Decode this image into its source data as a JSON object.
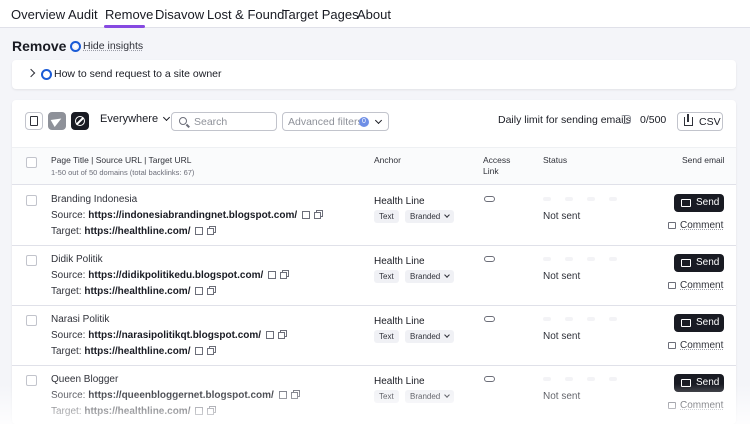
{
  "nav": {
    "tabs": [
      {
        "label": "Overview"
      },
      {
        "label": "Audit"
      },
      {
        "label": "Remove"
      },
      {
        "label": "Disavow"
      },
      {
        "label": "Lost & Found"
      },
      {
        "label": "Target Pages"
      },
      {
        "label": "About"
      }
    ],
    "active": "Remove"
  },
  "page": {
    "title": "Remove",
    "hide_insights": "Hide insights"
  },
  "howto": {
    "label": "How to send request to a site owner"
  },
  "toolbar": {
    "scope_select": "Everywhere",
    "search_placeholder": "Search",
    "advanced_filters": "Advanced filters",
    "advanced_filters_count": "0",
    "daily_limit_label": "Daily limit for sending emails",
    "daily_limit_value": "0/500",
    "csv_label": "CSV"
  },
  "table": {
    "headers": {
      "page": "Page Title | Source URL | Target URL",
      "page_sub": "1-50 out of 50 domains (total backlinks: 67)",
      "anchor": "Anchor",
      "access_line1": "Access",
      "access_line2": "Link",
      "status": "Status",
      "send_email": "Send email"
    },
    "source_prefix": "Source: ",
    "target_prefix": "Target: ",
    "send_label": "Send",
    "comment_label": "Comment",
    "rows": [
      {
        "name": "Branding Indonesia",
        "source": "https://indonesiabrandingnet.blogspot.com/",
        "target": "https://healthline.com/",
        "anchor": "Health Line",
        "tag_type": "Text",
        "tag_branded": "Branded",
        "status": "Not sent"
      },
      {
        "name": "Didik Politik",
        "source": "https://didikpolitikedu.blogspot.com/",
        "target": "https://healthline.com/",
        "anchor": "Health Line",
        "tag_type": "Text",
        "tag_branded": "Branded",
        "status": "Not sent"
      },
      {
        "name": "Narasi Politik",
        "source": "https://narasipolitikqt.blogspot.com/",
        "target": "https://healthline.com/",
        "anchor": "Health Line",
        "tag_type": "Text",
        "tag_branded": "Branded",
        "status": "Not sent"
      },
      {
        "name": "Queen Blogger",
        "source": "https://queenbloggernet.blogspot.com/",
        "target": "https://healthline.com/",
        "anchor": "Health Line",
        "tag_type": "Text",
        "tag_branded": "Branded",
        "status": "Not sent"
      }
    ]
  },
  "colors": {
    "accent": "#8649e1",
    "link_blue": "#1a5bd6",
    "button_dark": "#191b23",
    "text": "#191b23"
  }
}
